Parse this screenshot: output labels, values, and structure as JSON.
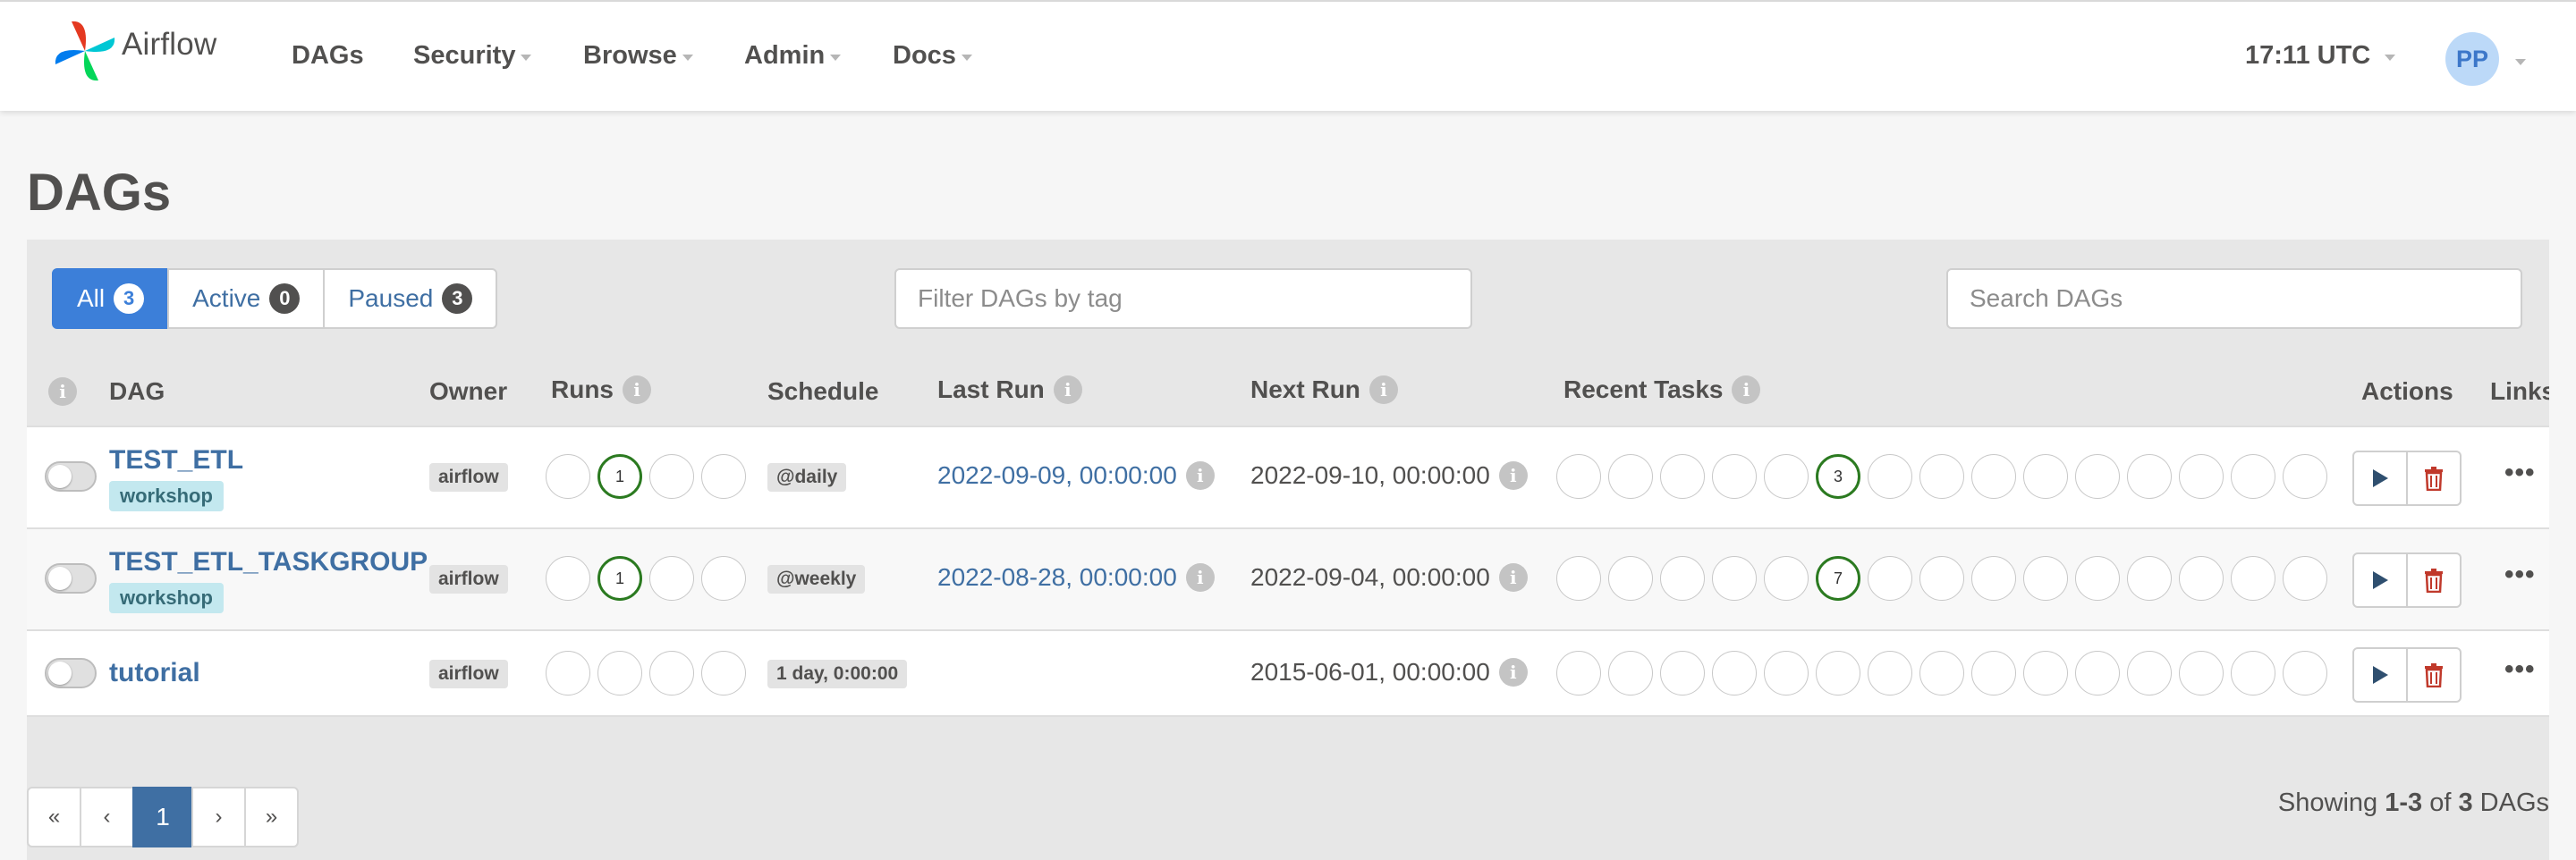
{
  "navbar": {
    "brand": "Airflow",
    "items": [
      {
        "label": "DAGs",
        "dropdown": false
      },
      {
        "label": "Security",
        "dropdown": true
      },
      {
        "label": "Browse",
        "dropdown": true
      },
      {
        "label": "Admin",
        "dropdown": true
      },
      {
        "label": "Docs",
        "dropdown": true
      }
    ],
    "clock": "17:11 UTC",
    "user_initials": "PP"
  },
  "page": {
    "title": "DAGs"
  },
  "filters": {
    "status": [
      {
        "label": "All",
        "count": "3",
        "active": true
      },
      {
        "label": "Active",
        "count": "0",
        "active": false
      },
      {
        "label": "Paused",
        "count": "3",
        "active": false
      }
    ],
    "tag_placeholder": "Filter DAGs by tag",
    "search_placeholder": "Search DAGs"
  },
  "table": {
    "headers": {
      "dag": "DAG",
      "owner": "Owner",
      "runs": "Runs",
      "schedule": "Schedule",
      "last_run": "Last Run",
      "next_run": "Next Run",
      "recent_tasks": "Recent Tasks",
      "actions": "Actions",
      "links": "Links"
    },
    "rows": [
      {
        "name": "TEST_ETL",
        "tag": "workshop",
        "owner": "airflow",
        "runs": [
          "",
          "1",
          "",
          ""
        ],
        "schedule": "@daily",
        "last_run": "2022-09-09, 00:00:00",
        "next_run": "2022-09-10, 00:00:00",
        "recent_tasks": [
          "",
          "",
          "",
          "",
          "",
          "3",
          "",
          "",
          "",
          "",
          "",
          "",
          "",
          "",
          ""
        ]
      },
      {
        "name": "TEST_ETL_TASKGROUP",
        "tag": "workshop",
        "owner": "airflow",
        "runs": [
          "",
          "1",
          "",
          ""
        ],
        "schedule": "@weekly",
        "last_run": "2022-08-28, 00:00:00",
        "next_run": "2022-09-04, 00:00:00",
        "recent_tasks": [
          "",
          "",
          "",
          "",
          "",
          "7",
          "",
          "",
          "",
          "",
          "",
          "",
          "",
          "",
          ""
        ]
      },
      {
        "name": "tutorial",
        "tag": "",
        "owner": "airflow",
        "runs": [
          "",
          "",
          "",
          ""
        ],
        "schedule": "1 day, 0:00:00",
        "last_run": "",
        "next_run": "2015-06-01, 00:00:00",
        "recent_tasks": [
          "",
          "",
          "",
          "",
          "",
          "",
          "",
          "",
          "",
          "",
          "",
          "",
          "",
          "",
          ""
        ]
      }
    ]
  },
  "pagination": {
    "first": "«",
    "prev": "‹",
    "current": "1",
    "next": "›",
    "last": "»",
    "showing_prefix": "Showing",
    "showing_range": "1-3",
    "showing_of": "of",
    "showing_total": "3",
    "showing_suffix": "DAGs"
  },
  "colors": {
    "accent": "#3c7fd9",
    "link": "#3f6fa3",
    "success_ring": "#2b7a20",
    "delete_red": "#c0392b",
    "tag_bg": "#c3e8ef"
  }
}
